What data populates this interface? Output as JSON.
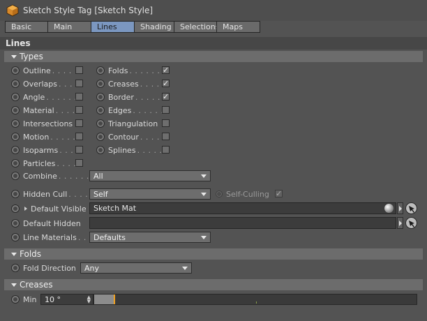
{
  "window": {
    "title": "Sketch Style Tag [Sketch Style]"
  },
  "tabs": [
    {
      "label": "Basic",
      "active": false
    },
    {
      "label": "Main",
      "active": false
    },
    {
      "label": "Lines",
      "active": true
    },
    {
      "label": "Shading",
      "active": false
    },
    {
      "label": "Selections",
      "active": false
    },
    {
      "label": "Maps",
      "active": false
    }
  ],
  "section": {
    "title": "Lines"
  },
  "types": {
    "title": "Types",
    "left": [
      {
        "label": "Outline",
        "dots": ". . . . .",
        "checked": false
      },
      {
        "label": "Overlaps",
        "dots": ". . . .",
        "checked": false
      },
      {
        "label": "Angle",
        "dots": ". . . . . .",
        "checked": false
      },
      {
        "label": "Material",
        "dots": ". . . .",
        "checked": false
      },
      {
        "label": "Intersections",
        "dots": "",
        "checked": false
      },
      {
        "label": "Motion",
        "dots": ". . . . .",
        "checked": false
      },
      {
        "label": "Isoparms",
        "dots": ". . . .",
        "checked": false
      },
      {
        "label": "Particles",
        "dots": ". . . .",
        "checked": false
      }
    ],
    "right": [
      {
        "label": "Folds",
        "dots": ". . . . . . .",
        "checked": true
      },
      {
        "label": "Creases",
        "dots": ". . . . .",
        "checked": true
      },
      {
        "label": "Border",
        "dots": ". . . . . .",
        "checked": true
      },
      {
        "label": "Edges",
        "dots": ". . . . . . .",
        "checked": false
      },
      {
        "label": "Triangulation",
        "dots": "",
        "checked": false
      },
      {
        "label": "Contour",
        "dots": ". . . . .",
        "checked": false
      },
      {
        "label": "Splines",
        "dots": ". . . . . .",
        "checked": false
      }
    ],
    "check_mark": "✓"
  },
  "combine": {
    "label": "Combine",
    "dots": ". . . . . . . .",
    "value": "All"
  },
  "hidden_cull": {
    "label": "Hidden Cull",
    "dots": ". . . . .",
    "value": "Self",
    "self_culling_label": "Self-Culling",
    "self_culling_checked": true
  },
  "default_visible": {
    "label": "Default Visible",
    "value": "Sketch Mat"
  },
  "default_hidden": {
    "label": "Default Hidden",
    "value": ""
  },
  "line_materials": {
    "label": "Line Materials",
    "dots": ". . .",
    "value": "Defaults"
  },
  "folds": {
    "title": "Folds",
    "direction_label": "Fold Direction",
    "direction_value": "Any"
  },
  "creases": {
    "title": "Creases",
    "min_label": "Min",
    "min_value": "10 °",
    "min_fraction": 0.06,
    "spin_up": "▲",
    "spin_down": "▼"
  }
}
